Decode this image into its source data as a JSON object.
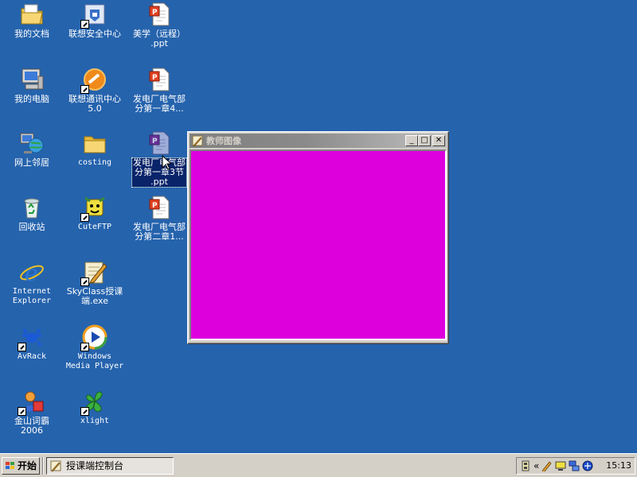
{
  "desktop": {
    "icons": [
      {
        "label": "我的文档",
        "name": "my-documents"
      },
      {
        "label": "联想安全中心",
        "name": "lenovo-security-center"
      },
      {
        "label": "美学（远程）\n.ppt",
        "name": "ppt-aesthetics"
      },
      {
        "label": "我的电脑",
        "name": "my-computer"
      },
      {
        "label": "联想通讯中心\n5.0",
        "name": "lenovo-communication-center"
      },
      {
        "label": "发电厂电气部\n分第一章4...",
        "name": "ppt-chapter1-4"
      },
      {
        "label": "网上邻居",
        "name": "network-places"
      },
      {
        "label": "costing",
        "name": "costing-folder"
      },
      {
        "label": "发电厂电气部\n分第一章3节\n.ppt",
        "name": "ppt-chapter1-3"
      },
      {
        "label": "回收站",
        "name": "recycle-bin"
      },
      {
        "label": "CuteFTP",
        "name": "cuteftp"
      },
      {
        "label": "发电厂电气部\n分第二章1...",
        "name": "ppt-chapter2-1"
      },
      {
        "label": "Internet\nExplorer",
        "name": "internet-explorer"
      },
      {
        "label": "SkyClass授课\n端.exe",
        "name": "skyclass"
      },
      {
        "label": "AvRack",
        "name": "avrack"
      },
      {
        "label": "Windows\nMedia Player",
        "name": "windows-media-player"
      },
      {
        "label": "金山词霸\n2006",
        "name": "kingsoft-powerword"
      },
      {
        "label": "xlight",
        "name": "xlight"
      }
    ]
  },
  "window": {
    "title": "教师图像",
    "minimize": "_",
    "maximize": "□",
    "close": "✕",
    "canvas_color": "#dd00dd"
  },
  "taskbar": {
    "start_label": "开始",
    "task_label": "授课端控制台",
    "tray_chevron": "«",
    "clock": "15:13"
  },
  "colors": {
    "desktop": "#2563ad",
    "taskbar": "#d4d0c8",
    "selection": "#0a246a"
  }
}
